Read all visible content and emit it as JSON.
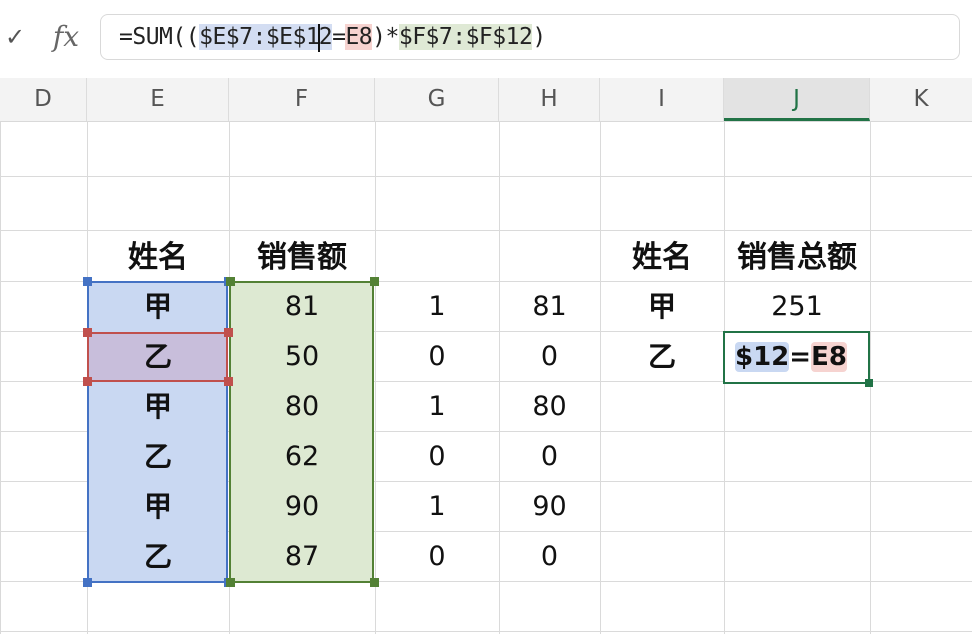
{
  "formula_bar": {
    "check_glyph": "✓",
    "fx_label": "fx",
    "formula_parts": {
      "prefix": "=SUM((",
      "ref_e_a": "$E$7:$E$1",
      "ref_e_b": "2",
      "eq": "=",
      "ref_e8": "E8",
      "mid": ")*",
      "ref_f": "$F$7:$F$12",
      "suffix": ")"
    }
  },
  "columns": [
    {
      "letter": "D"
    },
    {
      "letter": "E"
    },
    {
      "letter": "F"
    },
    {
      "letter": "G"
    },
    {
      "letter": "H"
    },
    {
      "letter": "I"
    },
    {
      "letter": "J"
    },
    {
      "letter": "K"
    }
  ],
  "active_column": "J",
  "table_left": {
    "header_name": "姓名",
    "header_sales": "销售额",
    "rows": [
      {
        "name": "甲",
        "sales": "81",
        "flag": "1",
        "product": "81"
      },
      {
        "name": "乙",
        "sales": "50",
        "flag": "0",
        "product": "0"
      },
      {
        "name": "甲",
        "sales": "80",
        "flag": "1",
        "product": "80"
      },
      {
        "name": "乙",
        "sales": "62",
        "flag": "0",
        "product": "0"
      },
      {
        "name": "甲",
        "sales": "90",
        "flag": "1",
        "product": "90"
      },
      {
        "name": "乙",
        "sales": "87",
        "flag": "0",
        "product": "0"
      }
    ]
  },
  "table_right": {
    "header_name": "姓名",
    "header_total": "销售总额",
    "row1_name": "甲",
    "row1_total": "251",
    "row2_name": "乙",
    "row2_edit": {
      "ref_a": "$12",
      "eq": "=",
      "ref_b": "E8"
    }
  },
  "colors": {
    "ref_blue": "#4472c4",
    "ref_green": "#538135",
    "ref_red": "#c0504d",
    "active": "#217346"
  }
}
